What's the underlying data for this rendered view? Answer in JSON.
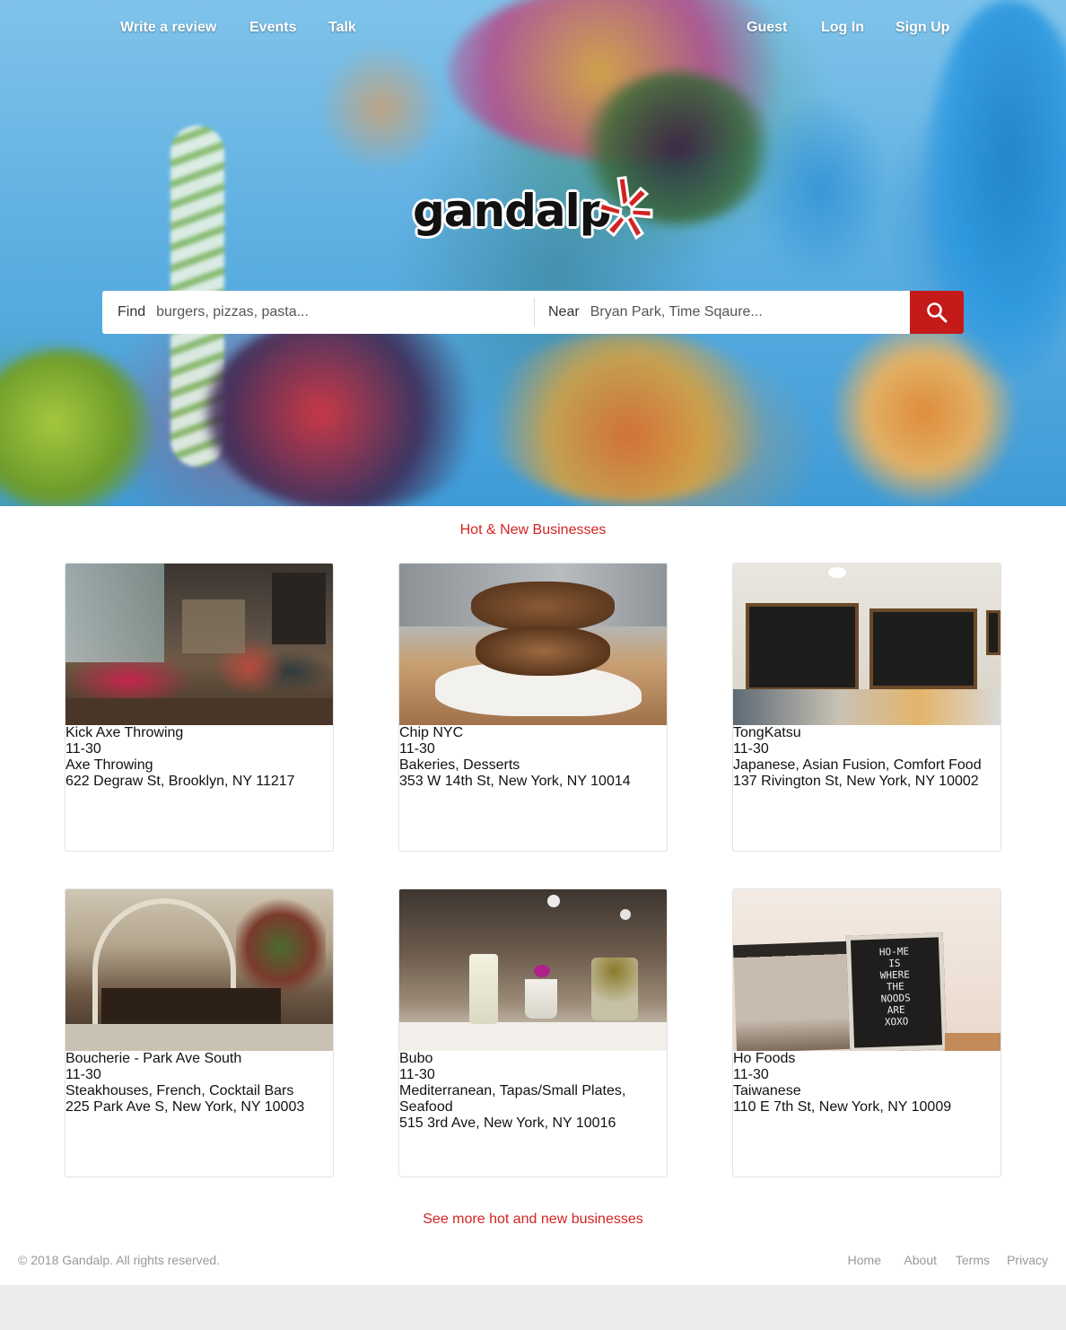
{
  "nav": {
    "write_review": "Write a review",
    "events": "Events",
    "talk": "Talk",
    "guest": "Guest",
    "login": "Log In",
    "signup": "Sign Up"
  },
  "logo": {
    "text": "gandalp",
    "icon": "burst-icon",
    "color": "#d32323"
  },
  "search": {
    "find_label": "Find",
    "find_placeholder": "burgers, pizzas, pasta...",
    "near_label": "Near",
    "near_placeholder": "Bryan Park, Time Sqaure...",
    "button_icon": "search-icon",
    "button_color": "#c41a1a"
  },
  "section": {
    "title": "Hot & New Businesses",
    "see_more": "See more hot and new businesses"
  },
  "businesses": [
    {
      "name": "Kick Axe Throwing",
      "hours": "11-30",
      "categories": "Axe Throwing",
      "address": "622 Degraw St, Brooklyn, NY 11217",
      "image": "lounge-photo"
    },
    {
      "name": "Chip NYC",
      "hours": "11-30",
      "categories": "Bakeries, Desserts",
      "address": "353 W 14th St, New York, NY 10014",
      "image": "cookie-photo"
    },
    {
      "name": "TongKatsu",
      "hours": "11-30",
      "categories": "Japanese, Asian Fusion, Comfort Food",
      "address": "137 Rivington St, New York, NY 10002",
      "image": "menu-board-photo"
    },
    {
      "name": "Boucherie - Park Ave South",
      "hours": "11-30",
      "categories": "Steakhouses, French, Cocktail Bars",
      "address": "225 Park Ave S, New York, NY 10003",
      "image": "restaurant-interior-photo"
    },
    {
      "name": "Bubo",
      "hours": "11-30",
      "categories_line1": "Mediterranean, Tapas/Small Plates,",
      "categories_line2": "Seafood",
      "address": "515 3rd Ave, New York, NY 10016",
      "image": "cocktails-photo"
    },
    {
      "name": "Ho Foods",
      "hours": "11-30",
      "categories": "Taiwanese",
      "address": "110 E 7th St, New York, NY 10009",
      "image": "letter-board-photo",
      "sign_text": "HO-ME IS WHERE THE NOODS ARE XOXO"
    }
  ],
  "footer": {
    "copyright": "© 2018 Gandalp. All rights reserved.",
    "links": [
      "Home",
      "About",
      "Terms",
      "Privacy"
    ]
  }
}
